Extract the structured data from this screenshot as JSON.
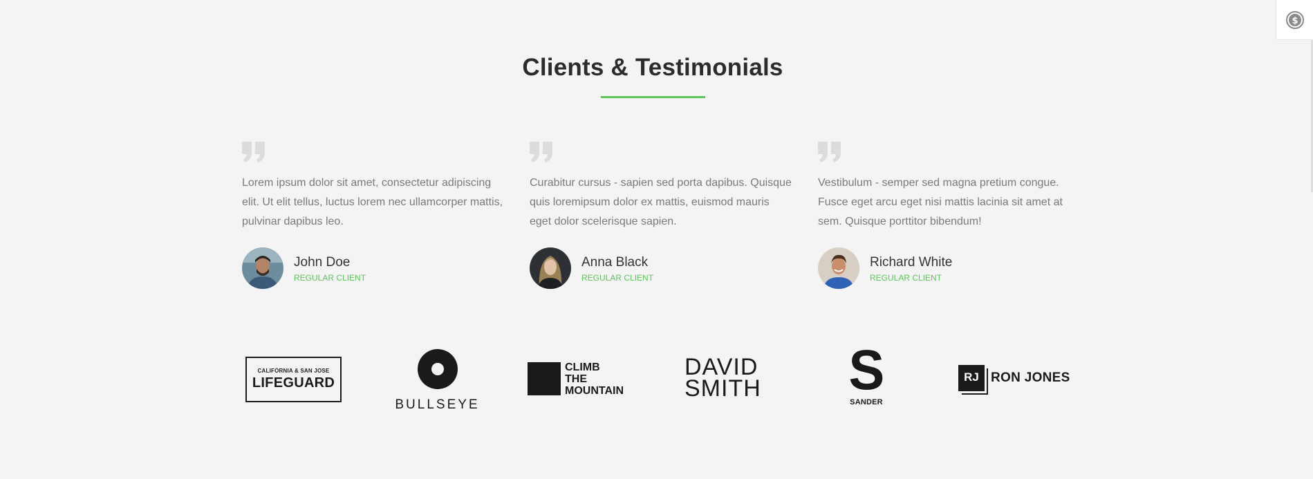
{
  "section": {
    "title": "Clients & Testimonials"
  },
  "colors": {
    "accent": "#5bc55a",
    "heading": "#2c2c2c",
    "body_text": "#7a7a7a",
    "quote_icon": "#dcdcdc",
    "background": "#f4f4f4"
  },
  "testimonials": [
    {
      "quote": "Lorem ipsum dolor sit amet, consectetur adipiscing elit. Ut elit tellus, luctus lorem nec ullamcorper mattis, pulvinar dapibus leo.",
      "name": "John Doe",
      "role": "REGULAR CLIENT",
      "avatar_icon": "man-portrait-avatar"
    },
    {
      "quote": "Curabitur cursus - sapien sed porta dapibus. Quisque quis loremipsum dolor ex mattis, euismod mauris eget dolor scelerisque sapien.",
      "name": "Anna Black",
      "role": "REGULAR CLIENT",
      "avatar_icon": "woman-portrait-avatar"
    },
    {
      "quote": "Vestibulum - semper sed magna pretium congue. Fusce eget arcu eget nisi mattis lacinia sit amet at sem. Quisque porttitor bibendum!",
      "name": "Richard White",
      "role": "REGULAR CLIENT",
      "avatar_icon": "man-portrait-avatar"
    }
  ],
  "logos": {
    "lifeguard_top": "CALIFORNIA & SAN JOSE",
    "lifeguard_main": "LIFEGUARD",
    "bullseye": "BULLSEYE",
    "climb": "CLIMB\nTHE\nMOUNTAIN",
    "david": "DAVID\nSMITH",
    "sander_mark": "S",
    "sander": "SANDER",
    "rj_mark": "RJ",
    "ronjones": "RON JONES"
  },
  "widget": {
    "icon": "dollar-coin-icon"
  }
}
